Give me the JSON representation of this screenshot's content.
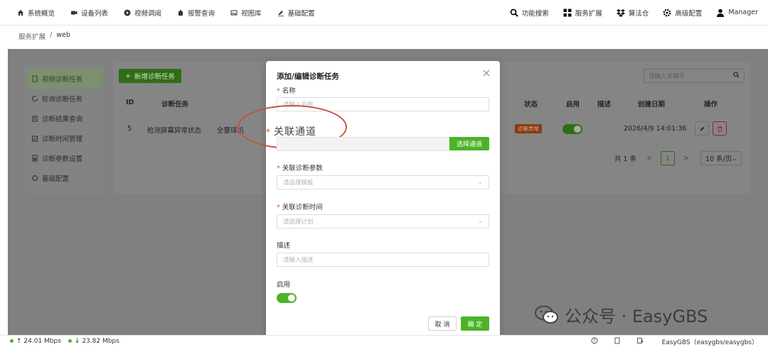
{
  "nav": {
    "left": [
      {
        "label": "系统概览",
        "icon": "home-icon"
      },
      {
        "label": "设备列表",
        "icon": "camera-icon"
      },
      {
        "label": "视频调阅",
        "icon": "play-icon"
      },
      {
        "label": "报警查询",
        "icon": "alarm-icon"
      },
      {
        "label": "视图库",
        "icon": "image-icon"
      },
      {
        "label": "基础配置",
        "icon": "edit-icon"
      }
    ],
    "right": [
      {
        "label": "功能搜索",
        "icon": "search-icon"
      },
      {
        "label": "服务扩展",
        "icon": "grid-icon"
      },
      {
        "label": "算法仓",
        "icon": "dropbox-icon"
      },
      {
        "label": "高级配置",
        "icon": "gear-icon"
      },
      {
        "label": "Manager",
        "icon": "user-icon"
      }
    ]
  },
  "breadcrumb": {
    "parent": "服务扩展",
    "sep": "/",
    "current": "web"
  },
  "sidebar": [
    {
      "label": "视频诊断任务",
      "active": true
    },
    {
      "label": "轮询诊断任务"
    },
    {
      "label": "诊断结果查询"
    },
    {
      "label": "诊断时间管理"
    },
    {
      "label": "诊断参数设置"
    },
    {
      "label": "基础配置"
    }
  ],
  "toolbar": {
    "add_label": "新增诊断任务",
    "search_placeholder": "请输入关键字"
  },
  "table": {
    "headers": [
      "ID",
      "诊断任务",
      "状态",
      "启用",
      "描述",
      "创建日期",
      "操作"
    ],
    "rows": [
      {
        "id": "5",
        "task": "检测屏幕异常状态",
        "extra": "全要球机",
        "status": "诊断异常",
        "enabled": true,
        "desc": "",
        "date": "2026/4/9 14:01:36"
      }
    ]
  },
  "pager": {
    "total": "共 1 条",
    "prev": "<",
    "page": "1",
    "next": ">",
    "size": "10 条/页"
  },
  "modal": {
    "title": "添加/编辑诊断任务",
    "name_label": "名称",
    "name_placeholder": "请输入名称",
    "channel_label": "关联通道",
    "channel_button": "选择通道",
    "param_label": "关联诊断参数",
    "param_placeholder": "请选择模板",
    "time_label": "关联诊断时间",
    "time_placeholder": "请选择计划",
    "desc_label": "描述",
    "desc_placeholder": "请输入描述",
    "enable_label": "启用",
    "enable_value": true,
    "cancel": "取 消",
    "confirm": "确 定",
    "required_mark": "*"
  },
  "watermark": {
    "text": "公众号 · EasyGBS"
  },
  "statusbar": {
    "upload": "↑ 24.01 Mbps",
    "download": "↓ 23.82 Mbps",
    "server": "EasyGBS（easygbs/easygbs）"
  },
  "colors": {
    "accent": "#4cb327",
    "danger": "#e04a3c",
    "annotation": "#c8513f"
  }
}
